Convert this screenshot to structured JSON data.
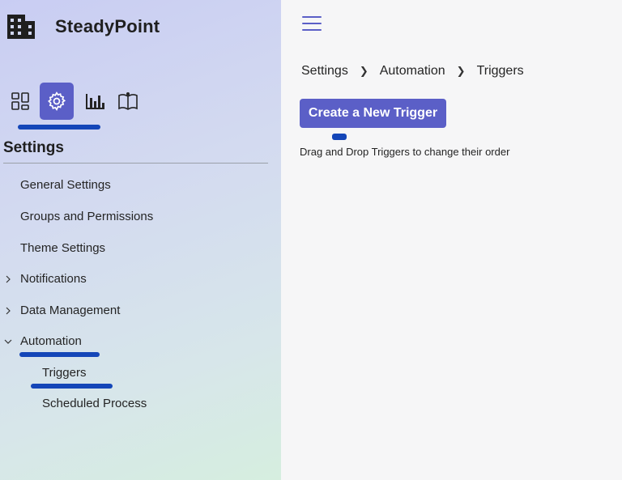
{
  "brand": {
    "name": "SteadyPoint",
    "logo_icon": "building-icon"
  },
  "icon_bar": {
    "items": [
      {
        "icon": "dashboard-icon"
      },
      {
        "icon": "gear-icon",
        "active": true
      },
      {
        "icon": "bar-chart-icon"
      },
      {
        "icon": "book-icon"
      }
    ]
  },
  "sidebar": {
    "heading": "Settings",
    "items": [
      {
        "label": "General Settings"
      },
      {
        "label": "Groups and Permissions"
      },
      {
        "label": "Theme Settings"
      },
      {
        "label": "Notifications",
        "expandable": true,
        "expanded": false
      },
      {
        "label": "Data Management",
        "expandable": true,
        "expanded": false
      },
      {
        "label": "Automation",
        "expandable": true,
        "expanded": true
      },
      {
        "label": "Triggers",
        "active": true
      },
      {
        "label": "Scheduled Process"
      }
    ]
  },
  "breadcrumb": {
    "items": [
      "Settings",
      "Automation",
      "Triggers"
    ]
  },
  "main": {
    "create_button_label": "Create a New Trigger",
    "hint": "Drag and Drop Triggers to change their order"
  },
  "colors": {
    "accent": "#5b5fc7",
    "annotation": "#1446b8"
  }
}
